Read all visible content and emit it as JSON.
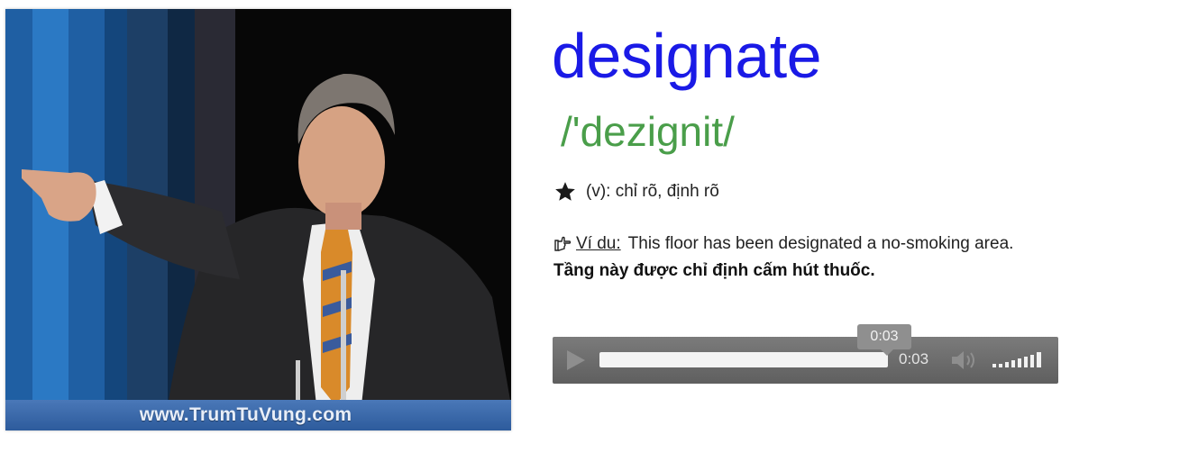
{
  "image": {
    "watermark": "www.TrumTuVung.com"
  },
  "entry": {
    "word": "designate",
    "phonetic": "/'dezignit/",
    "meaning": "(v): chỉ rõ, định rõ",
    "example_label": "Ví du:",
    "example_sentence": "This floor has been designated a no-smoking area.",
    "example_translation": "Tầng này được chỉ định cấm hút thuốc."
  },
  "player": {
    "current_time": "0:03",
    "tooltip_time": "0:03",
    "progress_fraction": 1.0
  },
  "colors": {
    "word": "#1a1ae6",
    "phonetic": "#4a9e4a",
    "player_bg": "#6e6e6e"
  },
  "icons": {
    "meaning": "star-icon",
    "example": "pointing-hand-icon",
    "play": "play-icon",
    "volume": "speaker-icon",
    "volume_level": "volume-bars-icon"
  }
}
